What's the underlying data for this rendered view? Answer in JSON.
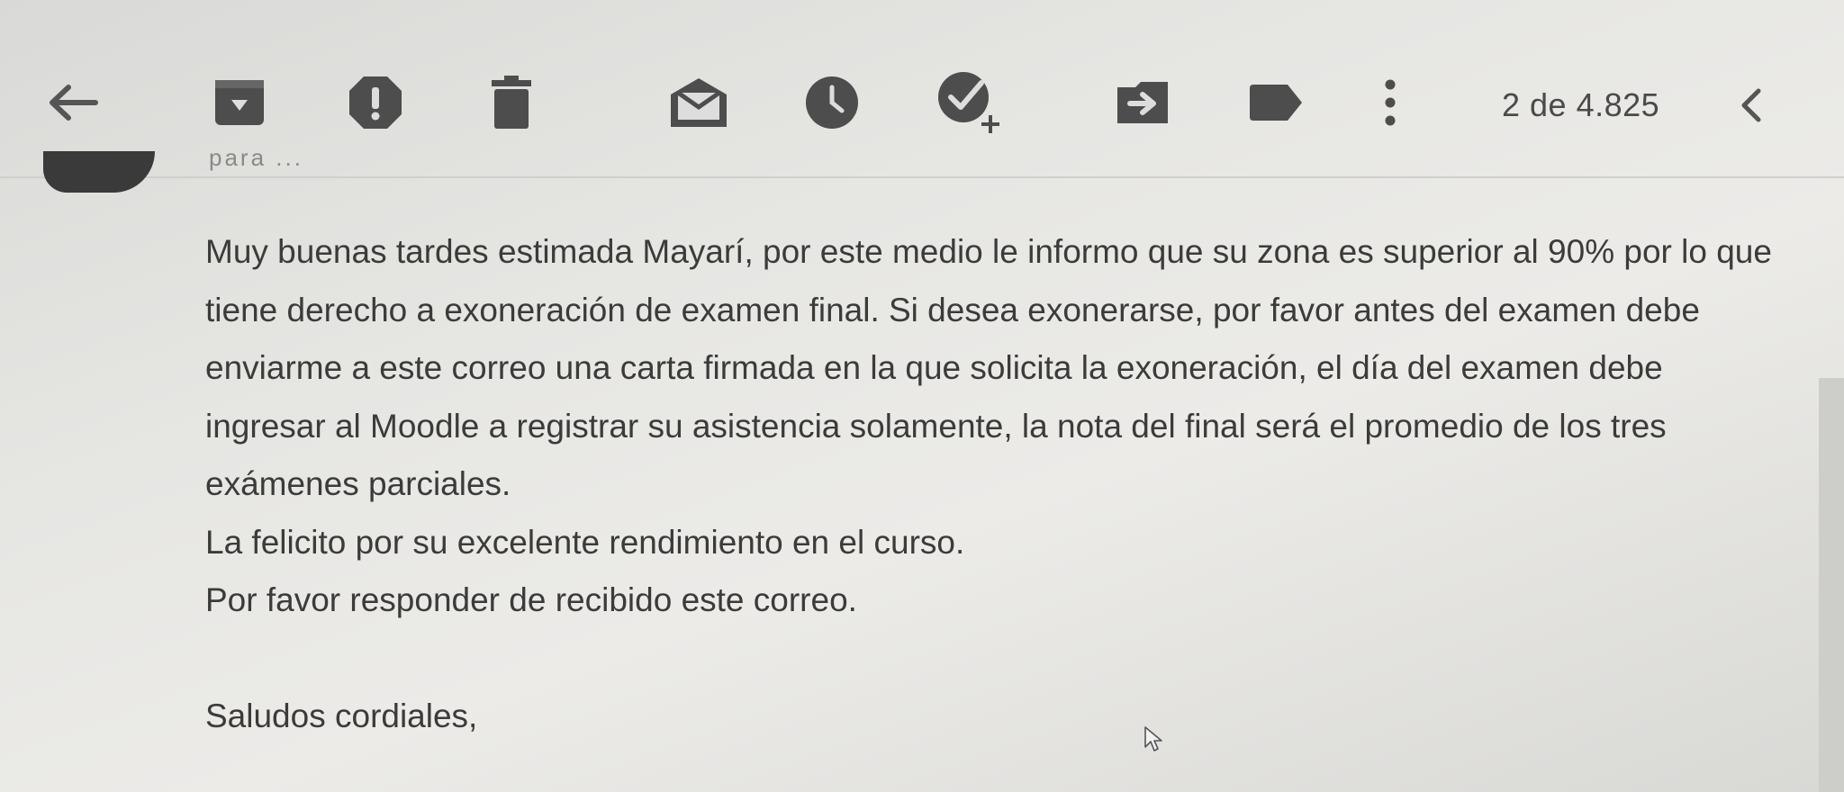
{
  "toolbar": {
    "icons": [
      "back-arrow-icon",
      "archive-icon",
      "report-spam-icon",
      "delete-icon",
      "mark-unread-icon",
      "snooze-icon",
      "add-to-tasks-icon",
      "move-to-icon",
      "labels-icon",
      "more-vert-icon",
      "chevron-left-icon"
    ],
    "pager_text": "2 de 4.825"
  },
  "message": {
    "to_line": "para ...",
    "paragraph": "Muy buenas tardes estimada Mayarí, por este medio le informo que su zona es superior al 90% por lo que tiene derecho a exoneración de examen final. Si desea exonerarse, por favor antes del examen debe enviarme a este correo una carta firmada en la que solicita la exoneración, el día del examen debe ingresar al Moodle a registrar su asistencia solamente, la nota del final será el promedio de los tres exámenes parciales.",
    "line_congrats": "La felicito por su excelente rendimiento en el curso.",
    "line_request": "Por favor responder de recibido este correo.",
    "signoff": "Saludos cordiales,"
  },
  "colors": {
    "icon": "#4d4d4d",
    "text": "#3b3b3b",
    "background": "#e6e6e3"
  }
}
